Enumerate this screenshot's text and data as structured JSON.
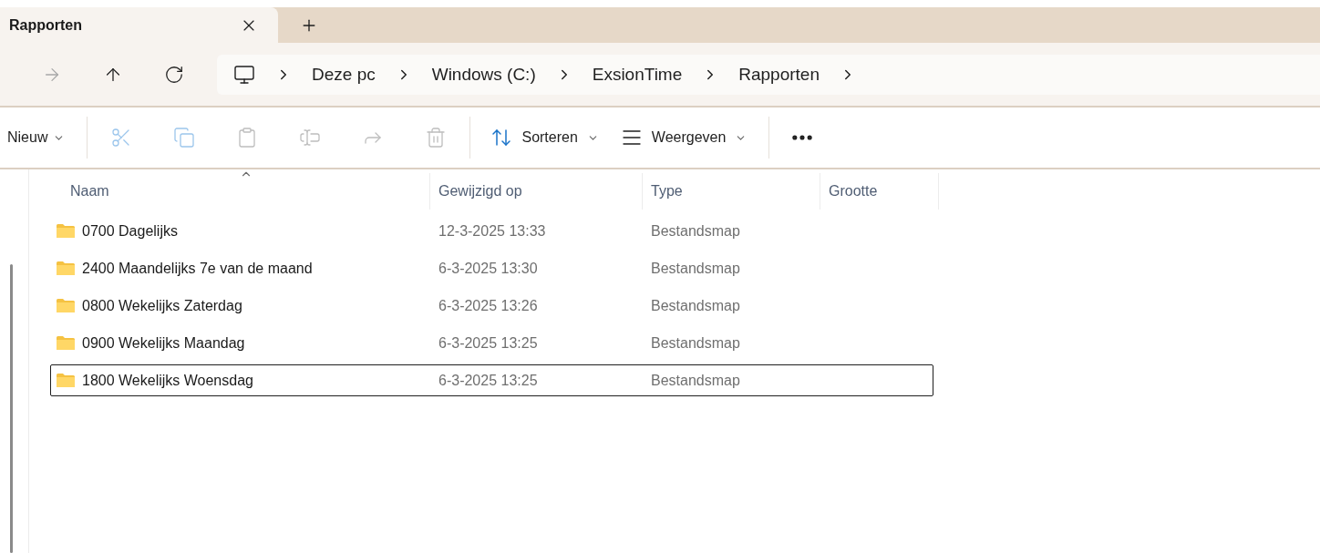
{
  "tabs": [
    {
      "label": "Rapporten",
      "selected": true
    }
  ],
  "nav": [
    {
      "kind": "forward",
      "disabled": true
    },
    {
      "kind": "up",
      "disabled": false
    },
    {
      "kind": "refresh",
      "disabled": false
    }
  ],
  "breadcrumb": [
    "Deze pc",
    "Windows (C:)",
    "ExsionTime",
    "Rapporten"
  ],
  "toolbar": {
    "new_label": "Nieuw",
    "actions": [
      {
        "kind": "cut",
        "disabled": true
      },
      {
        "kind": "copy",
        "disabled": true
      },
      {
        "kind": "paste",
        "disabled": true
      },
      {
        "kind": "rename",
        "disabled": true
      },
      {
        "kind": "share",
        "disabled": true
      },
      {
        "kind": "delete",
        "disabled": true
      }
    ],
    "sort_label": "Sorteren",
    "view_label": "Weergeven"
  },
  "table": {
    "columns": [
      {
        "label": "Naam",
        "sorted": true
      },
      {
        "label": "Gewijzigd op",
        "sorted": false
      },
      {
        "label": "Type",
        "sorted": false
      },
      {
        "label": "Grootte",
        "sorted": false
      }
    ],
    "rows": [
      {
        "name": "0700 Dagelijks",
        "modified": "12-3-2025 13:33",
        "type": "Bestandsmap",
        "focused": false
      },
      {
        "name": "2400 Maandelijks 7e van de maand",
        "modified": "6-3-2025 13:30",
        "type": "Bestandsmap",
        "focused": false
      },
      {
        "name": "0800 Wekelijks Zaterdag",
        "modified": "6-3-2025 13:26",
        "type": "Bestandsmap",
        "focused": false
      },
      {
        "name": "0900 Wekelijks Maandag",
        "modified": "6-3-2025 13:25",
        "type": "Bestandsmap",
        "focused": false
      },
      {
        "name": "1800 Wekelijks Woensdag",
        "modified": "6-3-2025 13:25",
        "type": "Bestandsmap",
        "focused": true
      }
    ]
  }
}
